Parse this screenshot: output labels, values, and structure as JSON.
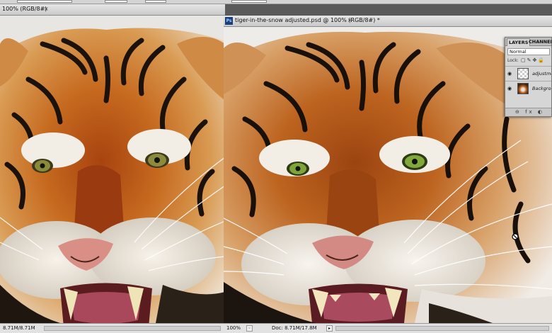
{
  "left_document": {
    "title": "100% (RGB/8#)",
    "close": "×",
    "status_zoom": "8.71M/8.71M"
  },
  "right_document": {
    "icon": "Ps",
    "title": "tiger-in-the-snow adjusted.psd @ 100% (RGB/8#) *",
    "close": "×",
    "status_zoom": "100%",
    "status_doc": "Doc: 8.71M/17.8M",
    "status_arrow": "▸"
  },
  "layers_panel": {
    "tabs": [
      "LAYERS",
      "CHANNELS"
    ],
    "blend_mode": "Normal",
    "lock_label": "Lock:",
    "layers": [
      {
        "name": "adjustmen",
        "icon": "eye-icon",
        "thumb": "checker"
      },
      {
        "name": "Backgrou",
        "icon": "eye-icon",
        "thumb": "tiger"
      }
    ],
    "footer_icons": "⊖ fx ◐ ▭"
  },
  "colors": {
    "window_bg": "#7b7b7b",
    "tab_bg": "#d6d6d6",
    "panel_bg": "#d6d6d6"
  }
}
